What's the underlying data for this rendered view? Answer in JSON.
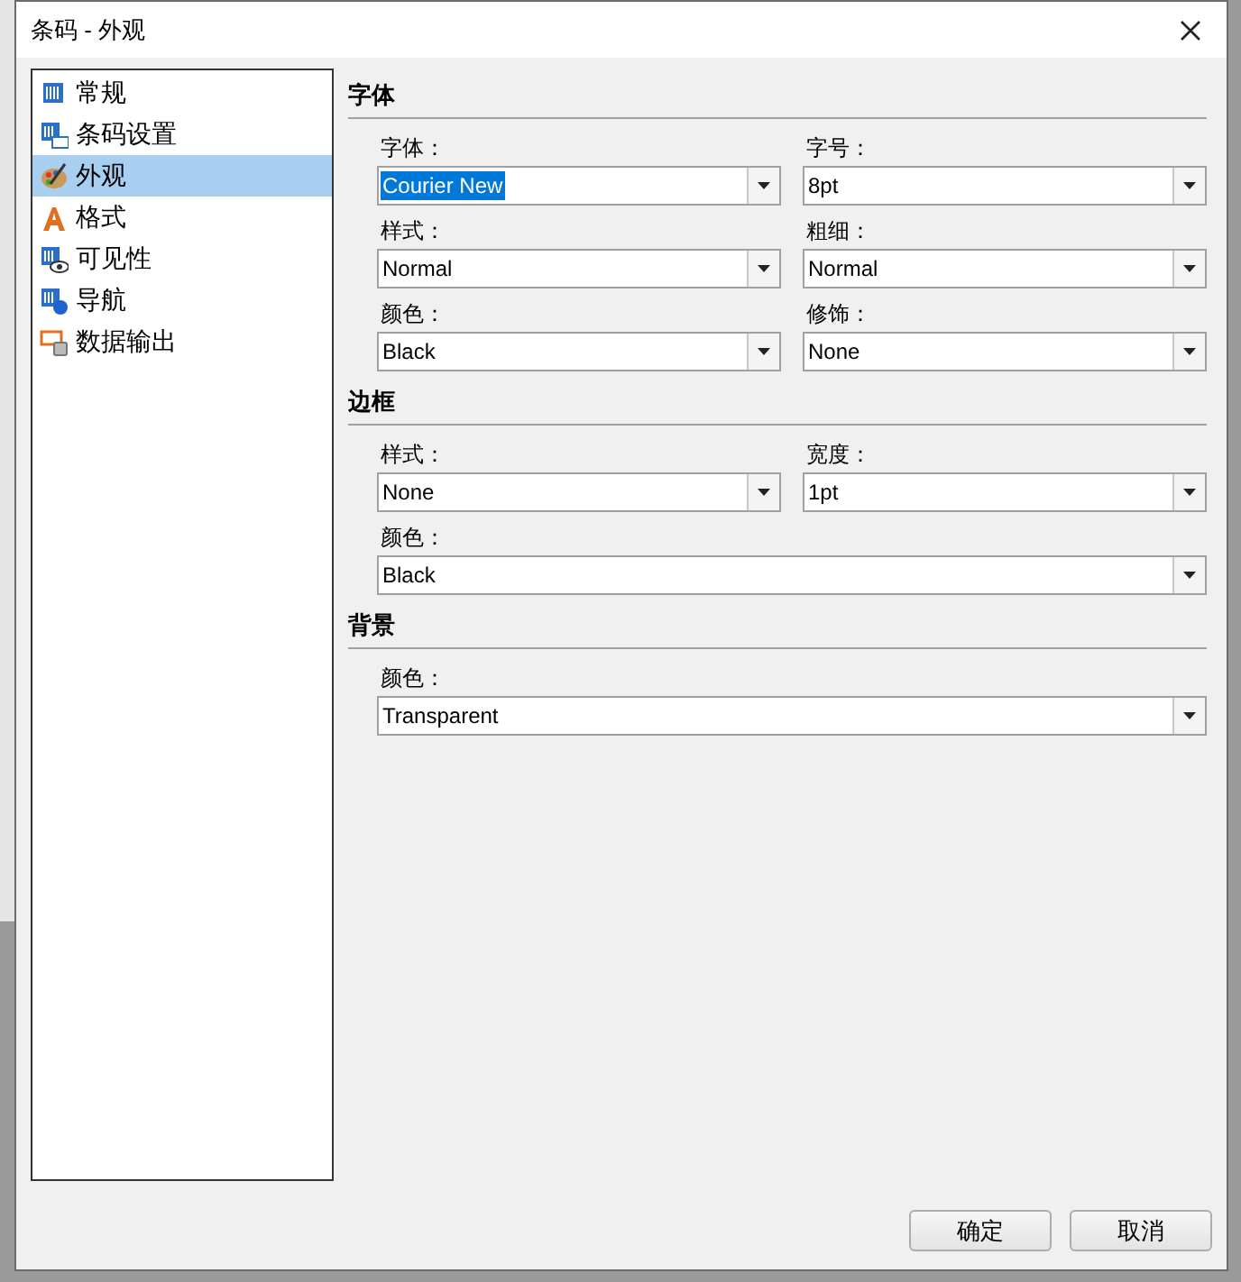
{
  "window": {
    "title": "条码 - 外观"
  },
  "sidebar": {
    "items": [
      {
        "label": "常规",
        "kind": "barcode",
        "selected": false
      },
      {
        "label": "条码设置",
        "kind": "settings",
        "selected": false
      },
      {
        "label": "外观",
        "kind": "palette",
        "selected": true
      },
      {
        "label": "格式",
        "kind": "font",
        "selected": false
      },
      {
        "label": "可见性",
        "kind": "visibility",
        "selected": false
      },
      {
        "label": "导航",
        "kind": "navigation",
        "selected": false
      },
      {
        "label": "数据输出",
        "kind": "export",
        "selected": false
      }
    ]
  },
  "sections": [
    {
      "title": "字体",
      "fields": [
        {
          "label": "字体：",
          "value": "Courier New",
          "kind": "half",
          "text_selected": true
        },
        {
          "label": "字号：",
          "value": "8pt",
          "kind": "half",
          "text_selected": false
        },
        {
          "label": "样式：",
          "value": "Normal",
          "kind": "half",
          "text_selected": false
        },
        {
          "label": "粗细：",
          "value": "Normal",
          "kind": "half",
          "text_selected": false
        },
        {
          "label": "颜色：",
          "value": "Black",
          "kind": "half",
          "text_selected": false
        },
        {
          "label": "修饰：",
          "value": "None",
          "kind": "half",
          "text_selected": false
        }
      ]
    },
    {
      "title": "边框",
      "fields": [
        {
          "label": "样式：",
          "value": "None",
          "kind": "half",
          "text_selected": false
        },
        {
          "label": "宽度：",
          "value": "1pt",
          "kind": "half",
          "text_selected": false
        },
        {
          "label": "颜色：",
          "value": "Black",
          "kind": "full",
          "text_selected": false
        }
      ]
    },
    {
      "title": "背景",
      "fields": [
        {
          "label": "颜色：",
          "value": "Transparent",
          "kind": "full",
          "text_selected": false
        }
      ]
    }
  ],
  "buttons": [
    "确定",
    "取消"
  ]
}
